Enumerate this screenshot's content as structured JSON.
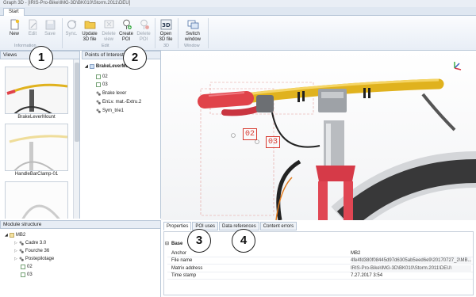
{
  "window": {
    "title": "Graph 3D - [IRIS-Pro-Bike\\IMG-3D\\BK010\\Storm.2011\\DEU]"
  },
  "ribbon": {
    "tab": "Start",
    "buttons": [
      {
        "id": "new",
        "label": "New",
        "enabled": true
      },
      {
        "id": "edit",
        "label": "Edit",
        "enabled": false
      },
      {
        "id": "save",
        "label": "Save",
        "enabled": false
      },
      {
        "id": "sync",
        "label": "Sync.",
        "enabled": false
      },
      {
        "id": "update",
        "label": "Update\n3D file",
        "enabled": true
      },
      {
        "id": "delete_view",
        "label": "Delete\nview",
        "enabled": false
      },
      {
        "id": "create_poi",
        "label": "Create\nPOI",
        "enabled": true
      },
      {
        "id": "delete_poi",
        "label": "Delete\nPOI",
        "enabled": false
      },
      {
        "id": "open3d",
        "label": "Open\n3D file",
        "enabled": true
      },
      {
        "id": "switch",
        "label": "Switch\nwindow",
        "enabled": true
      }
    ],
    "groups": {
      "information": "Information",
      "edit": "Edit",
      "3d": "3D",
      "window": "Window"
    }
  },
  "views": {
    "header": "Views",
    "items": [
      "BrakeLeverMount",
      "HandleBarClamp-01",
      ""
    ]
  },
  "poi": {
    "header": "Points of Interest",
    "root": "BrakeLeverMo...",
    "items": [
      "02",
      "03",
      "Brake lever",
      "EnLv. mat.-Extru.2",
      "Sym_trie1"
    ]
  },
  "module": {
    "header": "Module structure",
    "root": "MB2",
    "items": [
      "Cadre 3.0",
      "Fourche 36",
      "Postepilotage",
      "02",
      "03"
    ]
  },
  "properties": {
    "tabs": [
      "Properties",
      "POI uses",
      "Data references",
      "Content errors"
    ],
    "section": "Base",
    "rows": [
      {
        "key": "Anchor",
        "value": "MB2"
      },
      {
        "key": "File name",
        "value": "4fe4fd380f08445d97d6305ab5eed6e9\\20170727_2\\MB..."
      },
      {
        "key": "Matrix address",
        "value": "IRIS-Pro-Bike\\IMG-3D\\BK010\\Storm.2011\\DEU\\"
      },
      {
        "key": "Time stamp",
        "value": "7.27.2017 3:54"
      }
    ]
  },
  "viewport": {
    "labels": [
      "02",
      "03"
    ]
  },
  "callouts": [
    "1",
    "2",
    "3",
    "4"
  ],
  "colors": {
    "accent": "#d8392f",
    "handlebar": "#e0b21e",
    "grip": "#e0434a"
  }
}
